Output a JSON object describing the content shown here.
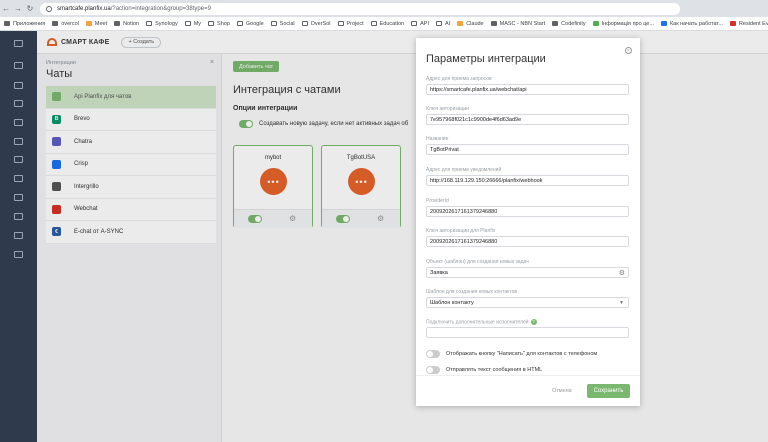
{
  "browser": {
    "url_host": "smartcafe.planfix.ua",
    "url_path": "/?action=integration&group=38type=9",
    "bookmarks": [
      {
        "label": "Приложения",
        "icon": "apps-icon",
        "kind": "grid"
      },
      {
        "label": "overcol",
        "icon": "site-icon",
        "kind": "site"
      },
      {
        "label": "Meet",
        "icon": "meet-icon",
        "kind": "orange"
      },
      {
        "label": "Notion",
        "icon": "notion-icon",
        "kind": "site"
      },
      {
        "label": "Synology",
        "icon": "folder-icon",
        "kind": "folder"
      },
      {
        "label": "My",
        "icon": "folder-icon",
        "kind": "folder"
      },
      {
        "label": "Shop",
        "icon": "folder-icon",
        "kind": "folder"
      },
      {
        "label": "Google",
        "icon": "folder-icon",
        "kind": "folder"
      },
      {
        "label": "Social",
        "icon": "folder-icon",
        "kind": "folder"
      },
      {
        "label": "OverSol",
        "icon": "folder-icon",
        "kind": "folder"
      },
      {
        "label": "Project",
        "icon": "folder-icon",
        "kind": "folder"
      },
      {
        "label": "Education",
        "icon": "folder-icon",
        "kind": "folder"
      },
      {
        "label": "API",
        "icon": "folder-icon",
        "kind": "folder"
      },
      {
        "label": "AI",
        "icon": "folder-icon",
        "kind": "folder"
      },
      {
        "label": "Claude",
        "icon": "claude-icon",
        "kind": "orange"
      },
      {
        "label": "MASC - NBN Start",
        "icon": "site-icon",
        "kind": "site"
      },
      {
        "label": "Codefinity",
        "icon": "codefinity-icon",
        "kind": "site"
      },
      {
        "label": "Інформація про це...",
        "icon": "site-icon",
        "kind": "green"
      },
      {
        "label": "Как начать работат...",
        "icon": "site-icon",
        "kind": "blue"
      },
      {
        "label": "Resident Evil Villag",
        "icon": "site-icon",
        "kind": "red"
      }
    ]
  },
  "app": {
    "logo_text": "СМАРТ КАФЕ",
    "create_label": "+ Создать"
  },
  "integrations_panel": {
    "subtitle": "Интеграции",
    "title": "Чаты",
    "close": "×",
    "items": [
      {
        "label": "Api Planfix для чатов",
        "icon": "api-icon",
        "color": "#7bb86f",
        "glyph": "",
        "active": true
      },
      {
        "label": "Brevo",
        "icon": "brevo-icon",
        "color": "#0b996e",
        "glyph": "B",
        "active": false
      },
      {
        "label": "Chatra",
        "icon": "chatra-icon",
        "color": "#5b5fc7",
        "glyph": "",
        "active": false
      },
      {
        "label": "Crisp",
        "icon": "crisp-icon",
        "color": "#1972f5",
        "glyph": "",
        "active": false
      },
      {
        "label": "Intergrillo",
        "icon": "intergrillo-icon",
        "color": "#555555",
        "glyph": "",
        "active": false
      },
      {
        "label": "Webchat",
        "icon": "webchat-icon",
        "color": "#d93025",
        "glyph": "",
        "active": false
      },
      {
        "label": "E-chat от A-SYNC",
        "icon": "echat-icon",
        "color": "#2b5fa8",
        "glyph": "€",
        "active": false
      }
    ]
  },
  "main": {
    "add_chat_label": "Добавить чат",
    "title": "Интеграция с чатами",
    "options_title": "Опции интеграции",
    "option_text": "Создавать новую задачу, если нет активных задач об",
    "cards": [
      {
        "name": "mybot",
        "enabled": true
      },
      {
        "name": "TgBotUSA",
        "enabled": true
      }
    ]
  },
  "modal": {
    "title": "Параметры интеграции",
    "fields": [
      {
        "label": "Адрес для приема запросов",
        "value": "https://smartcafe.planfix.ua/webchat/api"
      },
      {
        "label": "Ключ авторизации",
        "value": "7e957968f021c1c9900de4f6d63ad9e"
      },
      {
        "label": "Название",
        "value": "TgBotPrivat"
      },
      {
        "label": "Адрес для приема уведомлений",
        "value": "http://168.119.129.150:26666/planfix/webhook"
      },
      {
        "label": "ProviderId",
        "value": "2009202617161379246880"
      },
      {
        "label": "Ключ авторизации для Planfix",
        "value": "2009202617161379246880"
      },
      {
        "label": "Объект (шаблон) для создания новых задач",
        "value": "Заявка"
      },
      {
        "label": "Шаблон для создания новых контактов",
        "value": "Шаблон контакту"
      },
      {
        "label": "Подключить дополнительные исполнителей",
        "value": ""
      }
    ],
    "toggle_1": "Отображать кнопку \"Написать\" для контактов с телефоном",
    "toggle_2": "Отправлять текст сообщения в HTML",
    "cancel_label": "Отмена",
    "save_label": "Сохранить",
    "accent_color": "#7bb86f"
  }
}
